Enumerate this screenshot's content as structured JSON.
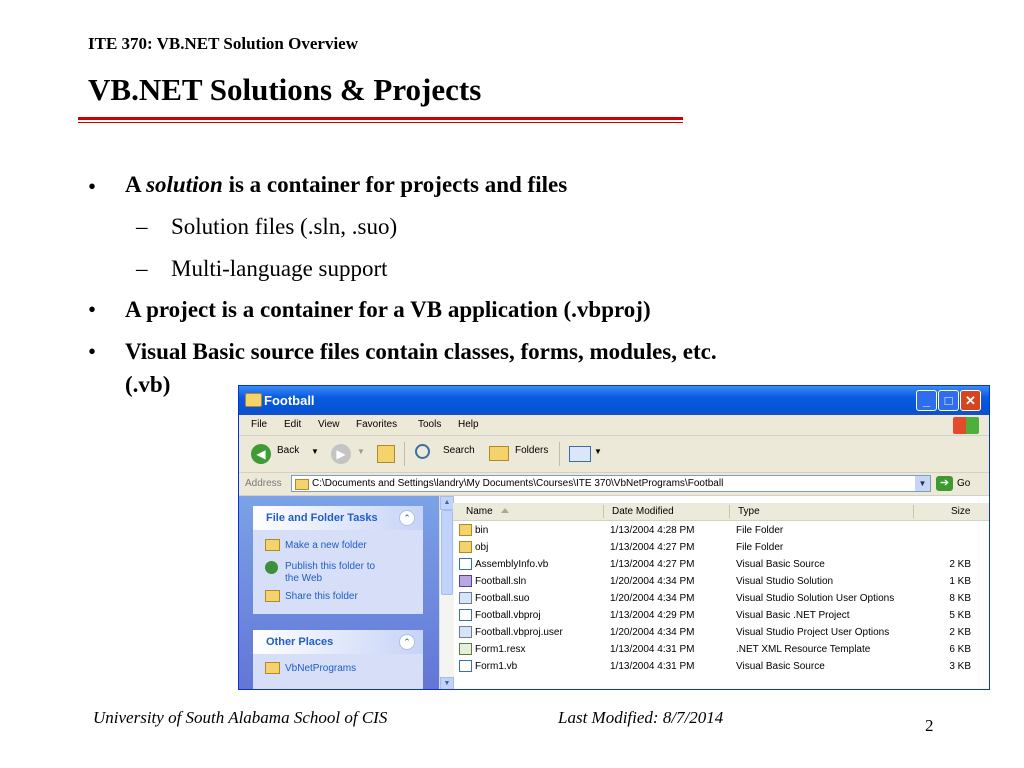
{
  "slide": {
    "header": "ITE 370: VB.NET Solution Overview",
    "title": "VB.NET Solutions & Projects",
    "bullet_char": "•",
    "dash_char": "–",
    "b1_a": "A ",
    "b1_em": "solution",
    "b1_b": " is a container for projects and files",
    "b1_sub1": "Solution files (.sln, .suo)",
    "b1_sub2": "Multi-language support",
    "b2": "A project is a container for a VB application (.vbproj)",
    "b3_line1": "Visual Basic source files contain classes, forms, modules, etc.",
    "b3_line2": "(.vb)",
    "footer_left": "University of South Alabama School of CIS",
    "footer_mid": "Last Modified: 8/7/2014",
    "page_number": "2"
  },
  "window": {
    "title": "Football",
    "menu": [
      "File",
      "Edit",
      "View",
      "Favorites",
      "Tools",
      "Help"
    ],
    "toolbar": {
      "back": "Back",
      "search": "Search",
      "folders": "Folders"
    },
    "address_label": "Address",
    "address_value": "C:\\Documents and Settings\\landry\\My Documents\\Courses\\ITE 370\\VbNetPrograms\\Football",
    "go_label": "Go",
    "tasks_title": "File and Folder Tasks",
    "tasks": [
      "Make a new folder",
      "Publish this folder to",
      "the Web",
      "Share this folder"
    ],
    "places_title": "Other Places",
    "places": [
      "VbNetPrograms"
    ],
    "columns": [
      "Name",
      "Date Modified",
      "Type",
      "Size"
    ],
    "files": [
      {
        "name": "bin",
        "date": "1/13/2004 4:28 PM",
        "type": "File Folder",
        "size": ""
      },
      {
        "name": "obj",
        "date": "1/13/2004 4:27 PM",
        "type": "File Folder",
        "size": ""
      },
      {
        "name": "AssemblyInfo.vb",
        "date": "1/13/2004 4:27 PM",
        "type": "Visual Basic Source",
        "size": "2 KB"
      },
      {
        "name": "Football.sln",
        "date": "1/20/2004 4:34 PM",
        "type": "Visual Studio Solution",
        "size": "1 KB"
      },
      {
        "name": "Football.suo",
        "date": "1/20/2004 4:34 PM",
        "type": "Visual Studio Solution User Options",
        "size": "8 KB"
      },
      {
        "name": "Football.vbproj",
        "date": "1/13/2004 4:29 PM",
        "type": "Visual Basic .NET Project",
        "size": "5 KB"
      },
      {
        "name": "Football.vbproj.user",
        "date": "1/20/2004 4:34 PM",
        "type": "Visual Studio Project User Options",
        "size": "2 KB"
      },
      {
        "name": "Form1.resx",
        "date": "1/13/2004 4:31 PM",
        "type": ".NET XML Resource Template",
        "size": "6 KB"
      },
      {
        "name": "Form1.vb",
        "date": "1/13/2004 4:31 PM",
        "type": "Visual Basic Source",
        "size": "3 KB"
      }
    ],
    "colors": {
      "titlebar": "#0a5ae0",
      "task_link": "#215dc6",
      "task_pane": "#7ba2e7",
      "rule": "#cc0000"
    }
  }
}
